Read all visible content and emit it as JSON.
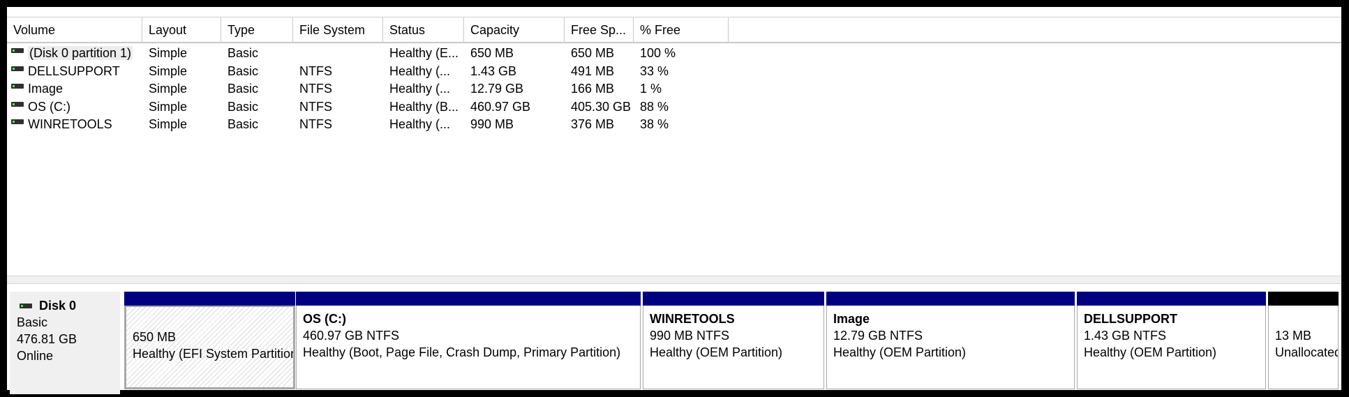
{
  "columns": [
    "Volume",
    "Layout",
    "Type",
    "File System",
    "Status",
    "Capacity",
    "Free Sp...",
    "% Free"
  ],
  "volumes": [
    {
      "volume": "(Disk 0 partition 1)",
      "layout": "Simple",
      "type": "Basic",
      "fs": "",
      "status": "Healthy (E...",
      "capacity": "650 MB",
      "free": "650 MB",
      "pct": "100 %"
    },
    {
      "volume": "DELLSUPPORT",
      "layout": "Simple",
      "type": "Basic",
      "fs": "NTFS",
      "status": "Healthy (...",
      "capacity": "1.43 GB",
      "free": "491 MB",
      "pct": "33 %"
    },
    {
      "volume": "Image",
      "layout": "Simple",
      "type": "Basic",
      "fs": "NTFS",
      "status": "Healthy (...",
      "capacity": "12.79 GB",
      "free": "166 MB",
      "pct": "1 %"
    },
    {
      "volume": "OS (C:)",
      "layout": "Simple",
      "type": "Basic",
      "fs": "NTFS",
      "status": "Healthy (B...",
      "capacity": "460.97 GB",
      "free": "405.30 GB",
      "pct": "88 %"
    },
    {
      "volume": "WINRETOOLS",
      "layout": "Simple",
      "type": "Basic",
      "fs": "NTFS",
      "status": "Healthy (...",
      "capacity": "990 MB",
      "free": "376 MB",
      "pct": "38 %"
    }
  ],
  "disk": {
    "name": "Disk 0",
    "type": "Basic",
    "size": "476.81 GB",
    "state": "Online",
    "icon": "disk-icon"
  },
  "partitions": [
    {
      "name": "",
      "size": "650 MB",
      "status": "Healthy (EFI System Partition)"
    },
    {
      "name": "OS  (C:)",
      "size": "460.97 GB NTFS",
      "status": "Healthy (Boot, Page File, Crash Dump, Primary Partition)"
    },
    {
      "name": "WINRETOOLS",
      "size": "990 MB NTFS",
      "status": "Healthy (OEM Partition)"
    },
    {
      "name": "Image",
      "size": "12.79 GB NTFS",
      "status": "Healthy (OEM Partition)"
    },
    {
      "name": "DELLSUPPORT",
      "size": "1.43 GB NTFS",
      "status": "Healthy (OEM Partition)"
    },
    {
      "name": "",
      "size": "13 MB",
      "status": "Unallocated"
    }
  ],
  "colors": {
    "primary_bar": "#000080",
    "unallocated_bar": "#000000"
  }
}
